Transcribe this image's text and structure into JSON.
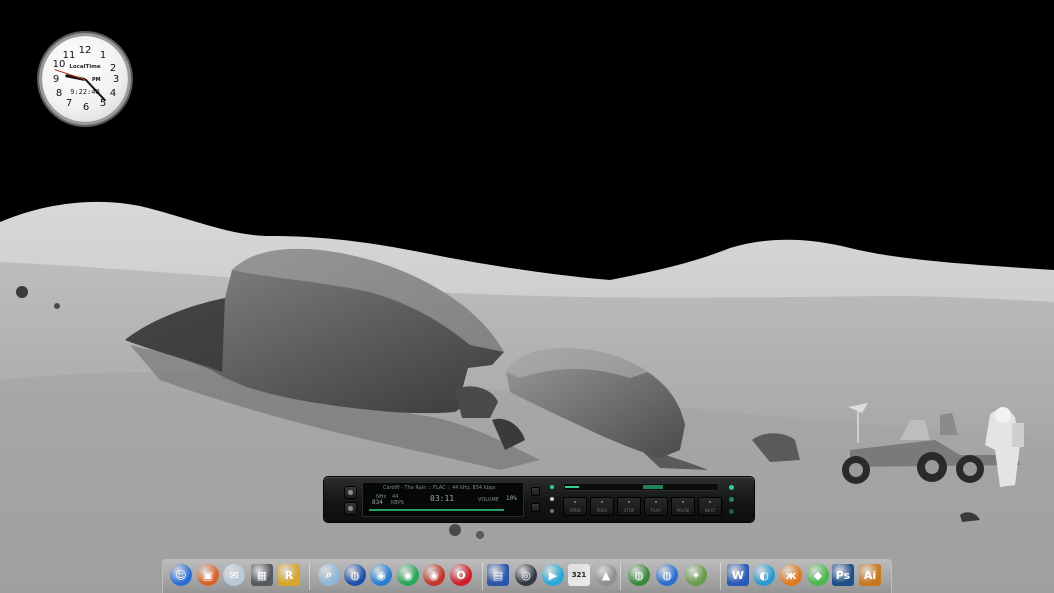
{
  "desktop": {
    "wallpaper": "lunar-surface-rover-astronaut"
  },
  "clock": {
    "numbers": [
      "12",
      "1",
      "2",
      "3",
      "4",
      "5",
      "6",
      "7",
      "8",
      "9",
      "10",
      "11"
    ],
    "brand": "LocalTime",
    "period": "PM",
    "digital_time": "9:22:48",
    "hour": 9,
    "minute": 22,
    "second": 48
  },
  "player": {
    "track_title": "Cardiff - The Rain :: FLAC :: 44 kHz, 834 kbps",
    "sample_rate_label": "NHz",
    "sample_rate": "44",
    "bitrate": "834",
    "bitrate_label": "KBPS",
    "time": "03:11",
    "volume_label": "VOLUME",
    "volume": "10%",
    "accent_color": "#2fd38b",
    "transport": [
      {
        "label": "OPEN",
        "icon": "eject-icon"
      },
      {
        "label": "PREV",
        "icon": "previous-icon"
      },
      {
        "label": "STOP",
        "icon": "stop-icon"
      },
      {
        "label": "PLAY",
        "icon": "play-icon"
      },
      {
        "label": "PAUSE",
        "icon": "pause-icon"
      },
      {
        "label": "NEXT",
        "icon": "next-icon"
      }
    ]
  },
  "dock": {
    "items": [
      {
        "name": "finder",
        "icon": "finder-icon",
        "glyph": "☺",
        "color": "#2b6fd6"
      },
      {
        "name": "toolbox",
        "icon": "toolbox-icon",
        "glyph": "▣",
        "color": "#d8632a"
      },
      {
        "name": "mail",
        "icon": "mail-icon",
        "glyph": "✉",
        "color": "#b7c9d8"
      },
      {
        "name": "calculator",
        "icon": "calculator-icon",
        "glyph": "▦",
        "color": "#555a60"
      },
      {
        "name": "r-app",
        "icon": "r-app-icon",
        "glyph": "R",
        "color": "#d6a62a"
      },
      {
        "name": "search",
        "icon": "magnifier-icon",
        "glyph": "⌕",
        "color": "#8fb7d8"
      },
      {
        "name": "network",
        "icon": "network-globe-icon",
        "glyph": "◍",
        "color": "#1f4fa8"
      },
      {
        "name": "browser-1",
        "icon": "browser-icon",
        "glyph": "◉",
        "color": "#2a7fd0"
      },
      {
        "name": "browser-2",
        "icon": "browser-green-icon",
        "glyph": "◉",
        "color": "#2aa85a"
      },
      {
        "name": "browser-3",
        "icon": "browser-red-green-icon",
        "glyph": "◉",
        "color": "#c0392b"
      },
      {
        "name": "opera",
        "icon": "opera-icon",
        "glyph": "O",
        "color": "#d01f2a"
      },
      {
        "name": "floppy",
        "icon": "floppy-disk-icon",
        "glyph": "▤",
        "color": "#2a56a8"
      },
      {
        "name": "camera",
        "icon": "camera-icon",
        "glyph": "◎",
        "color": "#333a44"
      },
      {
        "name": "media",
        "icon": "media-play-icon",
        "glyph": "▶",
        "color": "#2aa8d8"
      },
      {
        "name": "calendar",
        "icon": "calendar-icon",
        "glyph": "321",
        "color": "#e8e8e8"
      },
      {
        "name": "arrow",
        "icon": "arrow-circle-icon",
        "glyph": "▲",
        "color": "#8c8f93"
      },
      {
        "name": "earth",
        "icon": "earth-icon",
        "glyph": "◍",
        "color": "#3a8a3a"
      },
      {
        "name": "globe-2",
        "icon": "globe-icon",
        "glyph": "◍",
        "color": "#2a6fd0"
      },
      {
        "name": "satellite",
        "icon": "satellite-icon",
        "glyph": "✦",
        "color": "#6a9a4a"
      },
      {
        "name": "word",
        "icon": "word-icon",
        "glyph": "W",
        "color": "#2b5bb8"
      },
      {
        "name": "compass",
        "icon": "compass-icon",
        "glyph": "◐",
        "color": "#2a9ad0"
      },
      {
        "name": "butterfly",
        "icon": "butterfly-icon",
        "glyph": "ж",
        "color": "#e07a1f"
      },
      {
        "name": "emerald",
        "icon": "gem-icon",
        "glyph": "◆",
        "color": "#4ab84a"
      },
      {
        "name": "photoshop",
        "icon": "photoshop-icon",
        "glyph": "Ps",
        "color": "#1f4f8a"
      },
      {
        "name": "illustrator",
        "icon": "illustrator-icon",
        "glyph": "Ai",
        "color": "#c8781f"
      }
    ]
  }
}
